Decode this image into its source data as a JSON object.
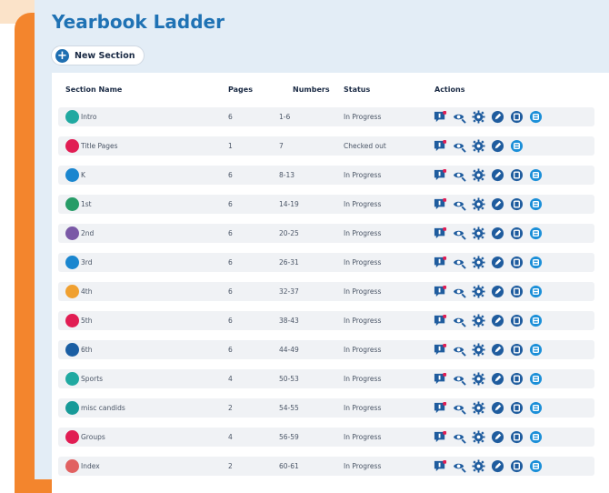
{
  "page": {
    "title": "Yearbook Ladder",
    "new_section_label": "New Section"
  },
  "table": {
    "headers": {
      "name": "Section Name",
      "pages": "Pages",
      "numbers": "Numbers",
      "status": "Status",
      "actions": "Actions"
    },
    "rows": [
      {
        "name": "Intro",
        "pages": "6",
        "numbers": "1-6",
        "status": "In Progress",
        "color": "#20a9a1",
        "actions": 6
      },
      {
        "name": "Title Pages",
        "pages": "1",
        "numbers": "7",
        "status": "Checked out",
        "color": "#e11d53",
        "actions": 5
      },
      {
        "name": "K",
        "pages": "6",
        "numbers": "8-13",
        "status": "In Progress",
        "color": "#1a86cf",
        "actions": 6
      },
      {
        "name": "1st",
        "pages": "6",
        "numbers": "14-19",
        "status": "In Progress",
        "color": "#279c67",
        "actions": 6
      },
      {
        "name": "2nd",
        "pages": "6",
        "numbers": "20-25",
        "status": "In Progress",
        "color": "#7a59a6",
        "actions": 6
      },
      {
        "name": "3rd",
        "pages": "6",
        "numbers": "26-31",
        "status": "In Progress",
        "color": "#1a86cf",
        "actions": 6
      },
      {
        "name": "4th",
        "pages": "6",
        "numbers": "32-37",
        "status": "In Progress",
        "color": "#f0a030",
        "actions": 6
      },
      {
        "name": "5th",
        "pages": "6",
        "numbers": "38-43",
        "status": "In Progress",
        "color": "#e11d53",
        "actions": 6
      },
      {
        "name": "6th",
        "pages": "6",
        "numbers": "44-49",
        "status": "In Progress",
        "color": "#1a5ea3",
        "actions": 6
      },
      {
        "name": "Sports",
        "pages": "4",
        "numbers": "50-53",
        "status": "In Progress",
        "color": "#20a9a1",
        "actions": 6
      },
      {
        "name": "misc candids",
        "pages": "2",
        "numbers": "54-55",
        "status": "In Progress",
        "color": "#179a98",
        "actions": 6
      },
      {
        "name": "Groups",
        "pages": "4",
        "numbers": "56-59",
        "status": "In Progress",
        "color": "#e11d53",
        "actions": 6
      },
      {
        "name": "Index",
        "pages": "2",
        "numbers": "60-61",
        "status": "In Progress",
        "color": "#e16161",
        "actions": 6
      }
    ]
  },
  "icons": {
    "action_names": [
      "comment-icon",
      "preview-icon",
      "settings-icon",
      "edit-icon",
      "copy-icon",
      "delete-icon"
    ],
    "accent": "#1f5c9e",
    "badge": "#e11d53"
  }
}
